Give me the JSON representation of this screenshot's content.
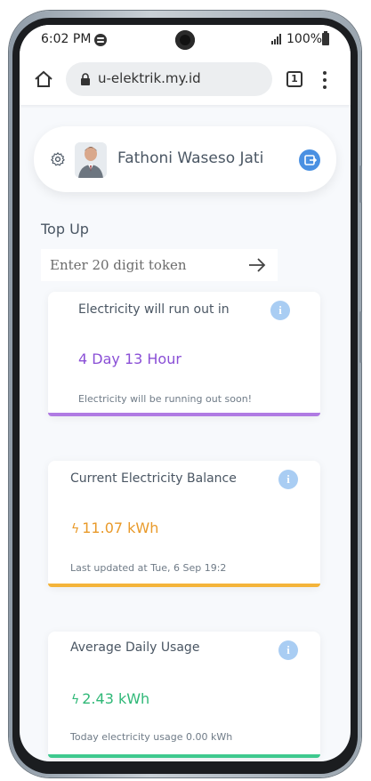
{
  "status_bar": {
    "time": "6:02 PM",
    "battery": "100%"
  },
  "browser": {
    "url": "u-elektrik.my.id",
    "tab_count": "1"
  },
  "profile": {
    "name": "Fathoni Waseso Jati"
  },
  "top_up": {
    "title": "Top Up",
    "placeholder": "Enter 20 digit token"
  },
  "cards": [
    {
      "title": "Electricity will run out in",
      "value": "4 Day 13 Hour",
      "note": "Electricity will be running out soon!",
      "accent": "#b07be3",
      "value_color": "#8a4fd6"
    },
    {
      "title": "Current Electricity Balance",
      "value": "11.07 kWh",
      "note": "Last updated at Tue, 6 Sep 19:2",
      "accent": "#f4b43a",
      "value_color": "#e99a2a"
    },
    {
      "title": "Average Daily Usage",
      "value": "2.43 kWh",
      "note": "Today electricity usage 0.00 kWh",
      "accent": "#3ec98e",
      "value_color": "#2fb877"
    }
  ],
  "icons": {
    "info": "i"
  }
}
